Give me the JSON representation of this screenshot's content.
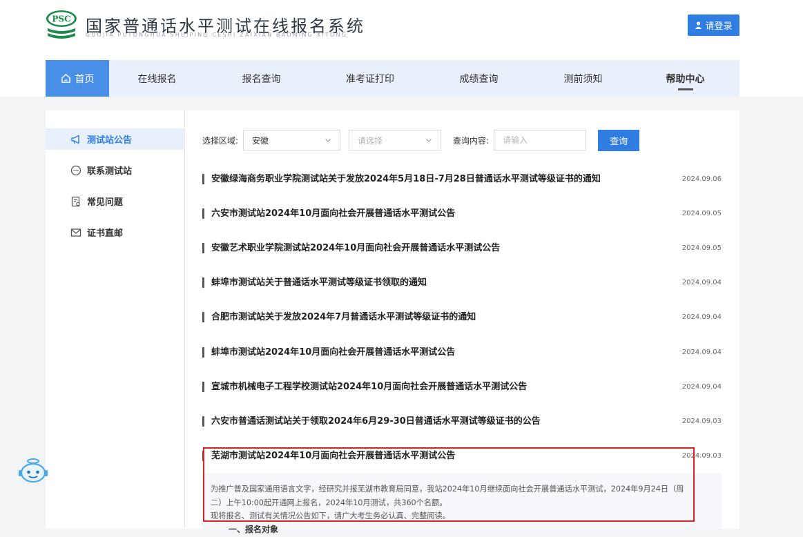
{
  "header": {
    "logo_text": "PSC",
    "title": "国家普通话水平测试在线报名系统",
    "subtitle": "GUOJIA PUTONGHUA SHUIPING CESHI ZAIXIAN BAOMING XITONG",
    "login_label": "请登录"
  },
  "nav": [
    {
      "label": "首页"
    },
    {
      "label": "在线报名"
    },
    {
      "label": "报名查询"
    },
    {
      "label": "准考证打印"
    },
    {
      "label": "成绩查询"
    },
    {
      "label": "测前须知"
    },
    {
      "label": "帮助中心"
    }
  ],
  "sidebar": [
    {
      "label": "测试站公告",
      "icon": "megaphone-icon"
    },
    {
      "label": "联系测试站",
      "icon": "chat-icon"
    },
    {
      "label": "常见问题",
      "icon": "faq-icon"
    },
    {
      "label": "证书直邮",
      "icon": "mail-icon"
    }
  ],
  "filters": {
    "region_label": "选择区域:",
    "region_value": "安徽",
    "city_placeholder": "请选择",
    "query_label": "查询内容:",
    "query_placeholder": "请输入",
    "search_label": "查询"
  },
  "announcements": [
    {
      "title": "安徽绿海商务职业学院测试站关于发放2024年5月18日-7月28日普通话水平测试等级证书的通知",
      "date": "2024.09.06"
    },
    {
      "title": "六安市测试站2024年10月面向社会开展普通话水平测试公告",
      "date": "2024.09.05"
    },
    {
      "title": "安徽艺术职业学院测试站2024年10月面向社会开展普通话水平测试公告",
      "date": "2024.09.05"
    },
    {
      "title": "蚌埠市测试站关于普通话水平测试等级证书领取的通知",
      "date": "2024.09.04"
    },
    {
      "title": "合肥市测试站关于发放2024年7月普通话水平测试等级证书的通知",
      "date": "2024.09.04"
    },
    {
      "title": "蚌埠市测试站2024年10月面向社会开展普通话水平测试公告",
      "date": "2024.09.04"
    },
    {
      "title": "宣城市机械电子工程学校测试站2024年10月面向社会开展普通话水平测试公告",
      "date": "2024.09.04"
    },
    {
      "title": "六安市普通话测试站关于领取2024年6月29-30日普通话水平测试等级证书的公告",
      "date": "2024.09.03"
    },
    {
      "title": "芜湖市测试站2024年10月面向社会开展普通话水平测试公告",
      "date": "2024.09.03"
    }
  ],
  "detail": {
    "line1": "为推广普及国家通用语言文字，经研究并报芜湖市教育局同意，我站2024年10月继续面向社会开展普通话水平测试，2024年9月24日（周",
    "line2": "二）上午10:00起开通网上报名，2024年10月测试，共360个名额。",
    "line3": "现将报名、测试有关情况公告如下，请广大考生务必认真、完整阅读。",
    "subheading": "一、报名对象"
  },
  "colors": {
    "accent": "#2f7de1",
    "nav_bg": "#e8f0fb",
    "highlight": "#d62222"
  }
}
